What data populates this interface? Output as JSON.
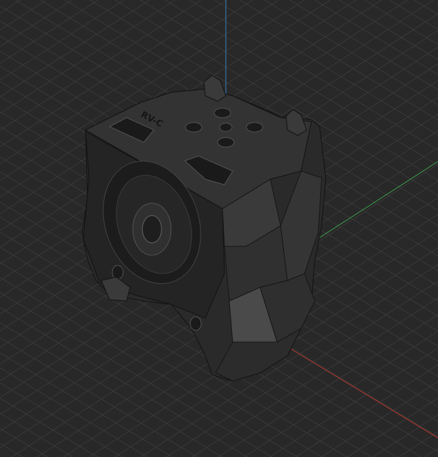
{
  "viewer": {
    "background": "#282828",
    "grid_color": "#3a3a3a",
    "axes": {
      "x_color": "#c0392b",
      "y_color": "#3fa34d",
      "z_color": "#3b82c4"
    }
  },
  "model": {
    "embossed_label": "RV-C",
    "body_color": "#2e2e2e"
  }
}
